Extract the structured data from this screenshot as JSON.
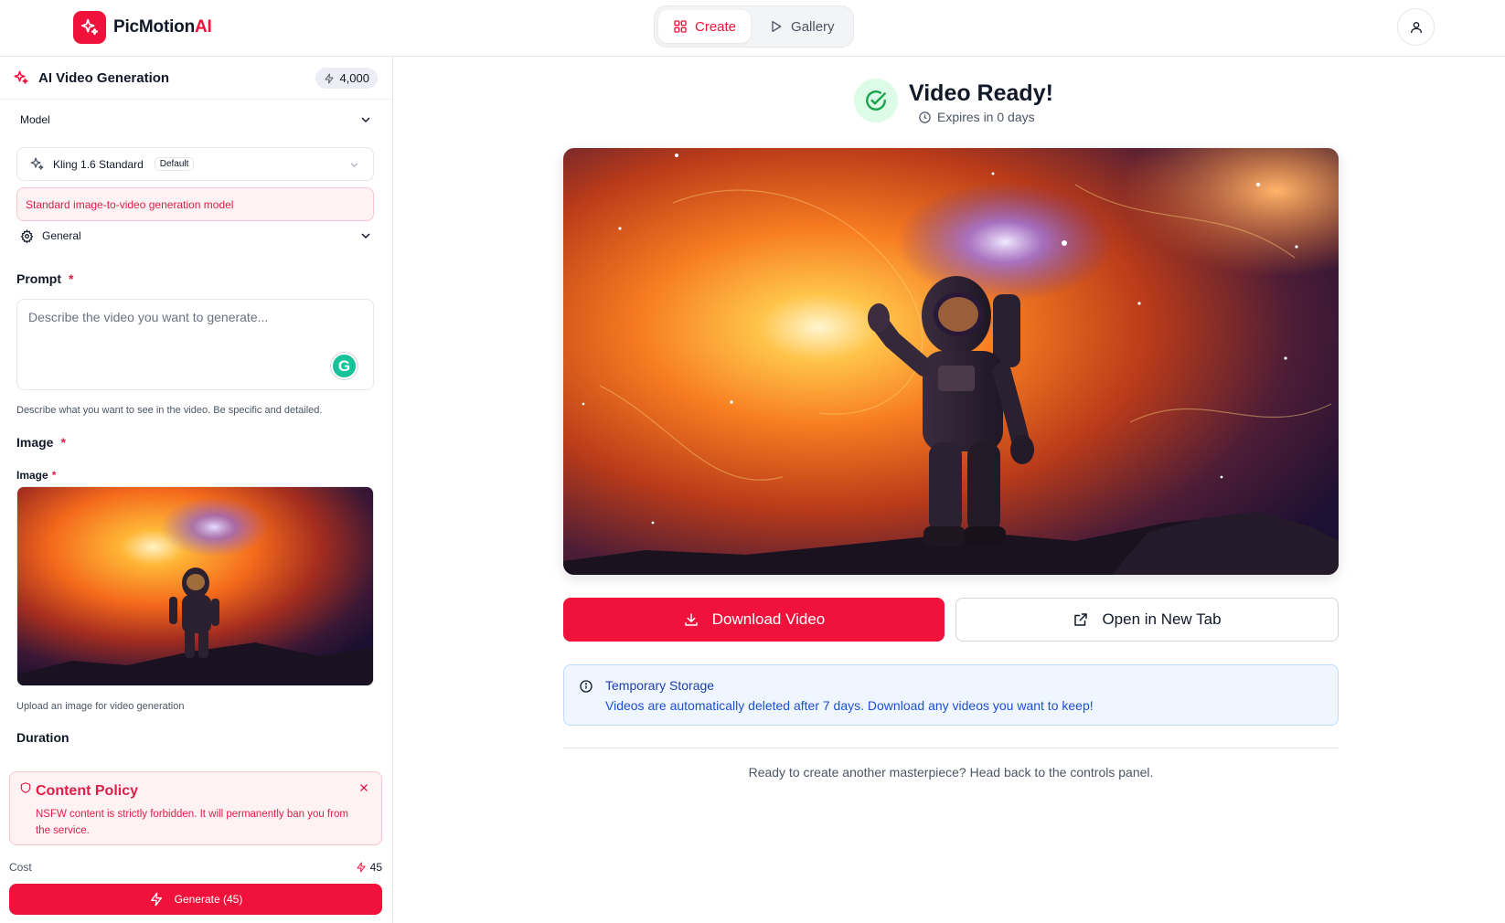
{
  "app": {
    "name_main": "PicMotion",
    "name_accent": "AI"
  },
  "nav": {
    "tabs": [
      {
        "label": "Create",
        "icon": "grid-icon",
        "active": true
      },
      {
        "label": "Gallery",
        "icon": "play-icon",
        "active": false
      }
    ]
  },
  "sidebar": {
    "title": "AI Video Generation",
    "credits": "4,000",
    "model_section": "Model",
    "model": {
      "name": "Kling 1.6 Standard",
      "badge": "Default",
      "description": "Standard image-to-video generation model"
    },
    "general_section": "General",
    "prompt": {
      "label": "Prompt",
      "required": "*",
      "placeholder": "Describe the video you want to generate...",
      "value": "",
      "help": "Describe what you want to see in the video. Be specific and detailed."
    },
    "image": {
      "section_label": "Image",
      "field_label": "Image",
      "required": "*",
      "help": "Upload an image for video generation"
    },
    "duration_label": "Duration",
    "content_policy": {
      "title": "Content Policy",
      "text": "NSFW content is strictly forbidden. It will permanently ban you from the service."
    },
    "cost_label": "Cost",
    "cost_value": "45",
    "generate_label": "Generate (45)"
  },
  "main": {
    "status_title": "Video Ready!",
    "expires": "Expires in 0 days",
    "download_label": "Download Video",
    "open_label": "Open in New Tab",
    "storage": {
      "title": "Temporary Storage",
      "text": "Videos are automatically deleted after 7 days. Download any videos you want to keep!"
    },
    "footer_note": "Ready to create another masterpiece? Head back to the controls panel."
  },
  "colors": {
    "brand": "#f0123a",
    "success": "#16a34a",
    "info": "#1d4ed8"
  }
}
